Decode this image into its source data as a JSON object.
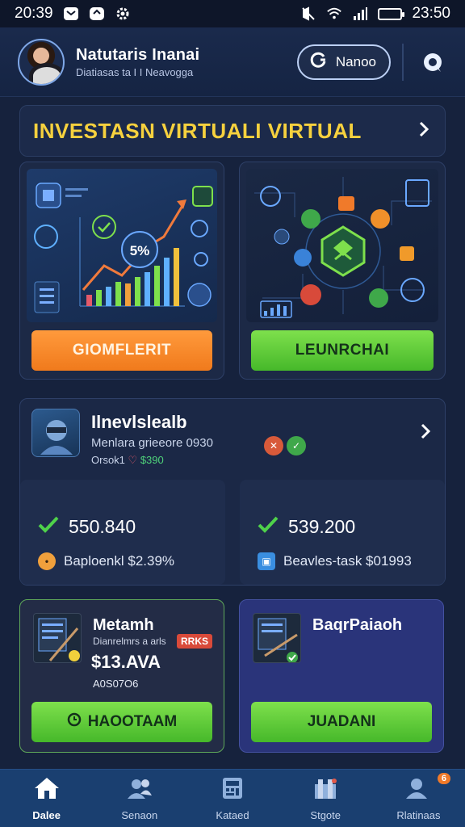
{
  "status_bar": {
    "time_left": "20:39",
    "time_right": "23:50"
  },
  "header": {
    "user_name": "Natutaris Inanai",
    "user_subtitle": "Diatiasas ta I I Neavogga",
    "pill_button_label": "Nanoo"
  },
  "banner": {
    "title": "INVESTASN VIRTUALI VIRTUAL"
  },
  "feature_cards": [
    {
      "art_label": "5%",
      "button_label": "GIOMFLERIT"
    },
    {
      "button_label": "LEUNRCHAI"
    }
  ],
  "portfolio": {
    "title": "Ilnevlslealb",
    "subtitle": "Menlara grieeore 0930",
    "meta_prefix": "Orsok1",
    "meta_value": "$390",
    "stats": [
      {
        "value": "550.840",
        "label": "Baploenkl $2.39%"
      },
      {
        "value": "539.200",
        "label": "Beavles-task $01993"
      }
    ]
  },
  "mini_cards": [
    {
      "title": "Metamh",
      "subtitle": "Dianrelmrs a arls",
      "badge": "RRKS",
      "price": "$13.AVA",
      "code": "A0S07O6",
      "button_label": "HAOOTAAM"
    },
    {
      "title": "BaqrPaiaoh",
      "button_label": "JUADANI"
    }
  ],
  "bottom_nav": {
    "items": [
      {
        "label": "Dalee",
        "icon": "home-icon"
      },
      {
        "label": "Senaon",
        "icon": "people-icon"
      },
      {
        "label": "Kataed",
        "icon": "calculator-icon"
      },
      {
        "label": "Stgote",
        "icon": "store-icon"
      },
      {
        "label": "Rlatinaas",
        "icon": "profile-icon",
        "badge": "6"
      }
    ]
  },
  "colors": {
    "background": "#16223d",
    "banner_title": "#f6d13e",
    "orange_cta": "#f07a1c",
    "green_cta": "#46b82a",
    "nav_bg": "#1a3f70"
  }
}
